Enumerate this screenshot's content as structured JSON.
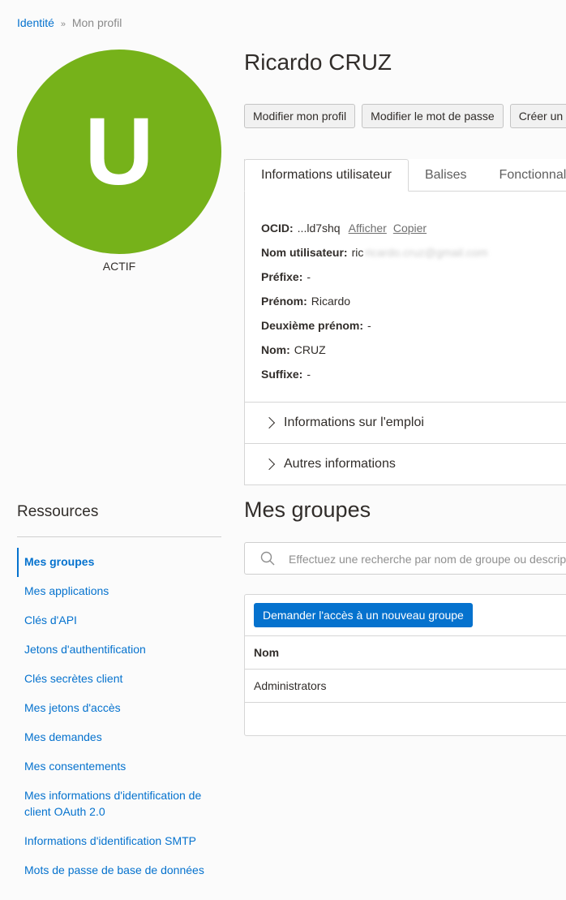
{
  "breadcrumb": {
    "root": "Identité",
    "separator": "»",
    "current": "Mon profil"
  },
  "profile": {
    "avatar_letter": "U",
    "avatar_color": "#76b21a",
    "status": "ACTIF",
    "name": "Ricardo CRUZ"
  },
  "actions": {
    "edit_profile": "Modifier mon profil",
    "change_password": "Modifier le mot de passe",
    "create": "Créer un l"
  },
  "tabs": [
    {
      "label": "Informations utilisateur",
      "active": true
    },
    {
      "label": "Balises",
      "active": false
    },
    {
      "label": "Fonctionnal",
      "active": false
    }
  ],
  "user_info": {
    "ocid": {
      "label": "OCID:",
      "value": "...ld7shq",
      "show": "Afficher",
      "copy": "Copier"
    },
    "username": {
      "label": "Nom utilisateur:",
      "value": "ric",
      "blurred": "ricardo.cruz@gmail.com"
    },
    "prefix": {
      "label": "Préfixe:",
      "value": "-"
    },
    "first_name": {
      "label": "Prénom:",
      "value": "Ricardo"
    },
    "middle_name": {
      "label": "Deuxième prénom:",
      "value": "-"
    },
    "last_name": {
      "label": "Nom:",
      "value": "CRUZ"
    },
    "suffix": {
      "label": "Suffixe:",
      "value": "-"
    }
  },
  "expanders": {
    "employment": "Informations sur l'emploi",
    "other": "Autres informations"
  },
  "resources": {
    "title": "Ressources",
    "items": [
      "Mes groupes",
      "Mes applications",
      "Clés d'API",
      "Jetons d'authentification",
      "Clés secrètes client",
      "Mes jetons d'accès",
      "Mes demandes",
      "Mes consentements",
      "Mes informations d'identification de client OAuth 2.0",
      "Informations d'identification SMTP",
      "Mots de passe de base de données"
    ]
  },
  "groups": {
    "title": "Mes groupes",
    "search_placeholder": "Effectuez une recherche par nom de groupe ou description",
    "request_button": "Demander l'accès à un nouveau groupe",
    "column_name": "Nom",
    "rows": [
      "Administrators"
    ]
  },
  "accent_color": "#0572ce"
}
